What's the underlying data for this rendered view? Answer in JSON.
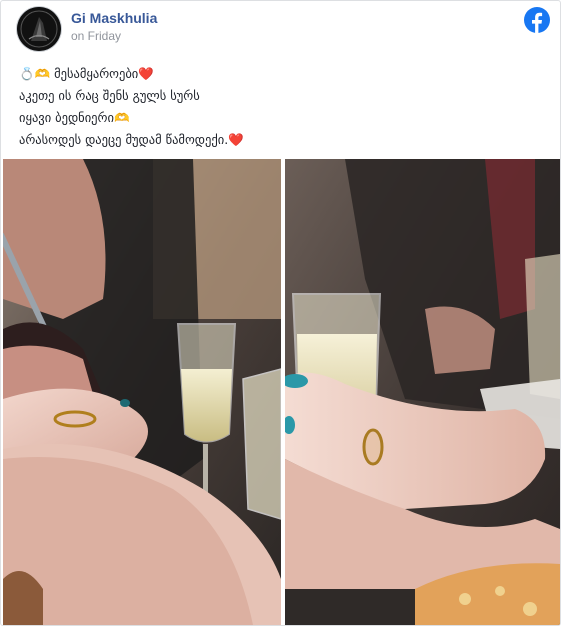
{
  "post": {
    "author": "Gi Maskhulia",
    "timestamp": "on Friday",
    "brand_icon": "facebook-logo-icon",
    "brand_color": "#1877f2",
    "author_color": "#385898",
    "caption_lines": [
      "💍🫶 მესამყაროები❤️",
      "აკეთე ის რაც შენს გულს სურს",
      "იყავი ბედნიერი🫶",
      "არასოდეს დაეცე მუდამ წამოდექი.❤️"
    ],
    "photos": [
      {
        "icon": "photo-champagne-ring-left"
      },
      {
        "icon": "photo-champagne-ring-right"
      }
    ]
  }
}
